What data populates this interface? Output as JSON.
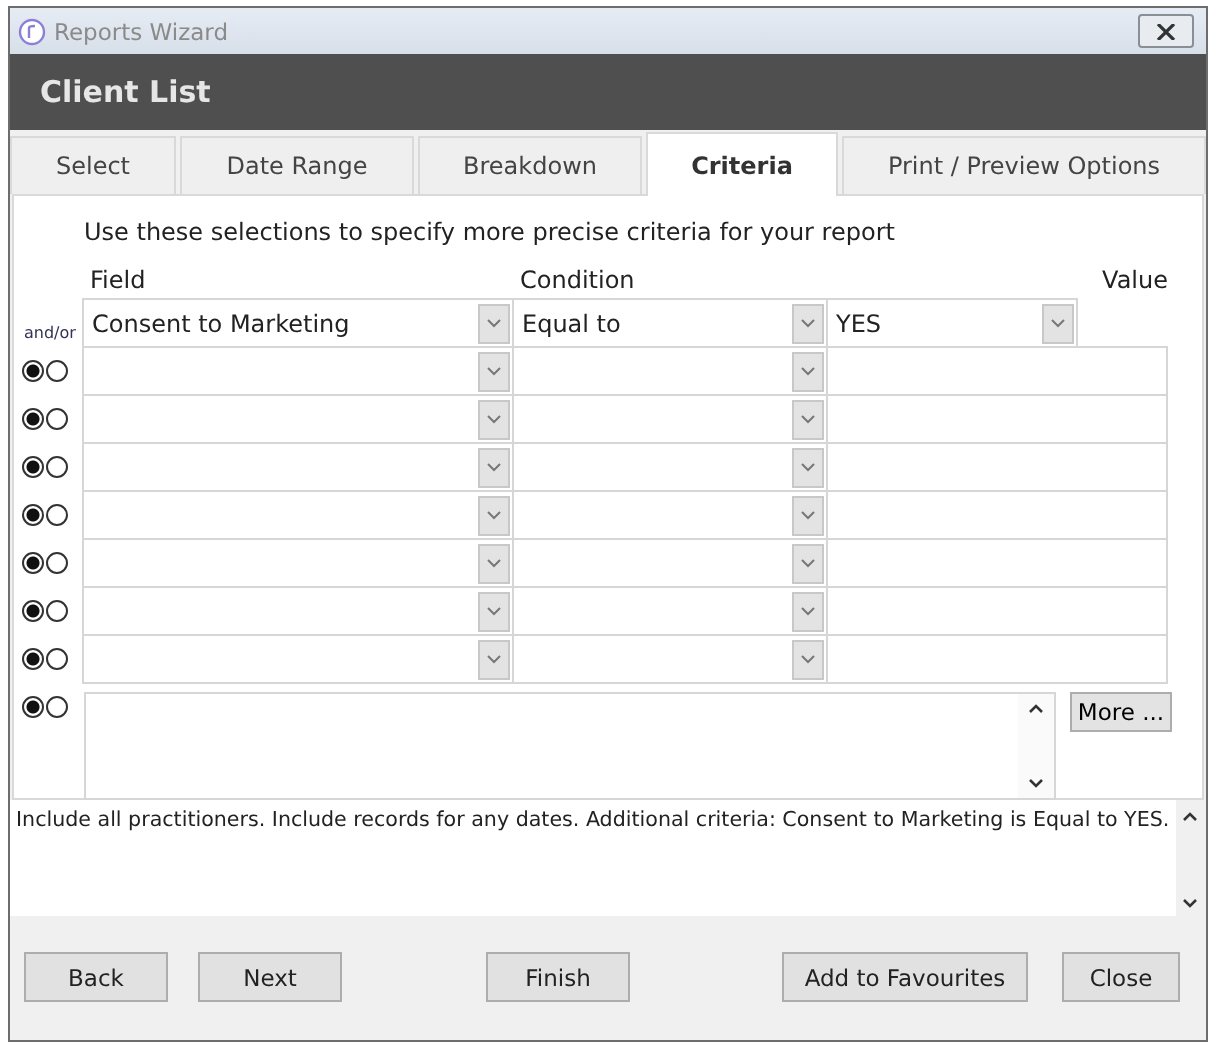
{
  "window": {
    "title": "Reports Wizard"
  },
  "header": {
    "title": "Client List"
  },
  "tabs": [
    {
      "label": "Select",
      "selected": false
    },
    {
      "label": "Date Range",
      "selected": false
    },
    {
      "label": "Breakdown",
      "selected": false
    },
    {
      "label": "Criteria",
      "selected": true
    },
    {
      "label": "Print / Preview Options",
      "selected": false
    }
  ],
  "instructions": "Use these selections to specify more precise criteria for your report",
  "columns": {
    "field": "Field",
    "condition": "Condition",
    "value": "Value"
  },
  "and_or_label": "and/or",
  "criteria": [
    {
      "kind": "first",
      "field": "Consent to Marketing",
      "condition": "Equal to",
      "value": "YES"
    },
    {
      "kind": "clause",
      "and_selected": true
    },
    {
      "kind": "clause",
      "and_selected": true
    },
    {
      "kind": "clause",
      "and_selected": true
    },
    {
      "kind": "clause",
      "and_selected": true
    },
    {
      "kind": "clause",
      "and_selected": true
    },
    {
      "kind": "clause",
      "and_selected": true
    },
    {
      "kind": "clause",
      "and_selected": true
    }
  ],
  "extra_criteria": {
    "and_selected": true
  },
  "more_button": "More ...",
  "summary": "Include all practitioners. Include records for any dates. Additional criteria: Consent to Marketing is Equal to YES.",
  "buttons": [
    "Back",
    "Next",
    "Finish",
    "Add to Favourites",
    "Close"
  ]
}
